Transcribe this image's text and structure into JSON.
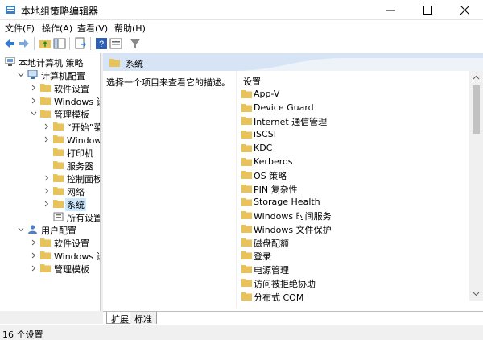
{
  "window": {
    "title": "本地组策略编辑器"
  },
  "menu": [
    "文件(F)",
    "操作(A)",
    "查看(V)",
    "帮助(H)"
  ],
  "tree": {
    "items": [
      {
        "label": "本地计算机 策略",
        "level": 0,
        "expander": "none",
        "icon": "computer-policy-icon"
      },
      {
        "label": "计算机配置",
        "level": 1,
        "expander": "expanded",
        "icon": "computer-icon"
      },
      {
        "label": "软件设置",
        "level": 2,
        "expander": "collapsed",
        "icon": "folder-icon"
      },
      {
        "label": "Windows 设置",
        "level": 2,
        "expander": "collapsed",
        "icon": "folder-icon"
      },
      {
        "label": "管理模板",
        "level": 2,
        "expander": "expanded",
        "icon": "folder-icon"
      },
      {
        "label": "“开始”菜单和",
        "level": 3,
        "expander": "collapsed",
        "icon": "folder-icon"
      },
      {
        "label": "Windows 组",
        "level": 3,
        "expander": "collapsed",
        "icon": "folder-icon"
      },
      {
        "label": "打印机",
        "level": 3,
        "expander": "none",
        "icon": "folder-icon"
      },
      {
        "label": "服务器",
        "level": 3,
        "expander": "none",
        "icon": "folder-icon"
      },
      {
        "label": "控制面板",
        "level": 3,
        "expander": "collapsed",
        "icon": "folder-icon"
      },
      {
        "label": "网络",
        "level": 3,
        "expander": "collapsed",
        "icon": "folder-icon"
      },
      {
        "label": "系统",
        "level": 3,
        "expander": "collapsed",
        "icon": "folder-icon",
        "selected": true
      },
      {
        "label": "所有设置",
        "level": 3,
        "expander": "none",
        "icon": "all-settings-icon"
      },
      {
        "label": "用户配置",
        "level": 1,
        "expander": "expanded",
        "icon": "user-icon"
      },
      {
        "label": "软件设置",
        "level": 2,
        "expander": "collapsed",
        "icon": "folder-icon"
      },
      {
        "label": "Windows 设置",
        "level": 2,
        "expander": "collapsed",
        "icon": "folder-icon"
      },
      {
        "label": "管理模板",
        "level": 2,
        "expander": "collapsed",
        "icon": "folder-icon"
      }
    ]
  },
  "right": {
    "header_title": "系统",
    "description": "选择一个项目来查看它的描述。",
    "column_header": "设置",
    "items": [
      "App-V",
      "Device Guard",
      "Internet 通信管理",
      "iSCSI",
      "KDC",
      "Kerberos",
      "OS 策略",
      "PIN 复杂性",
      "Storage Health",
      "Windows 时间服务",
      "Windows 文件保护",
      "磁盘配额",
      "登录",
      "电源管理",
      "访问被拒绝协助",
      "分布式 COM"
    ]
  },
  "tabs": [
    "扩展",
    "标准"
  ],
  "status": "16 个设置",
  "colors": {
    "folder": "#e8c25a",
    "header_bg": "#d6e4f5",
    "selection": "#cce8ff"
  }
}
